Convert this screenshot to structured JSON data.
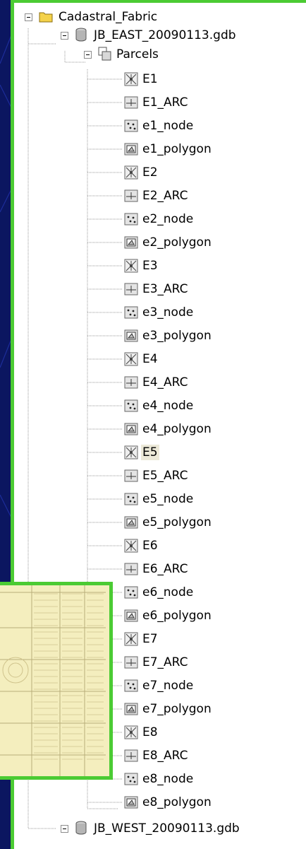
{
  "tree": {
    "root": {
      "label": "Cadastral_Fabric",
      "icon": "folder-icon",
      "expanded": true
    },
    "databases": [
      {
        "label": "JB_EAST_20090113.gdb",
        "icon": "geodatabase-icon",
        "expanded": true,
        "dataset": {
          "label": "Parcels",
          "icon": "feature-dataset-icon",
          "expanded": true,
          "items": [
            {
              "label": "E1",
              "icon": "topology-icon"
            },
            {
              "label": "E1_ARC",
              "icon": "line-feature-class-icon"
            },
            {
              "label": "e1_node",
              "icon": "point-feature-class-icon"
            },
            {
              "label": "e1_polygon",
              "icon": "polygon-feature-class-icon"
            },
            {
              "label": "E2",
              "icon": "topology-icon"
            },
            {
              "label": "E2_ARC",
              "icon": "line-feature-class-icon"
            },
            {
              "label": "e2_node",
              "icon": "point-feature-class-icon"
            },
            {
              "label": "e2_polygon",
              "icon": "polygon-feature-class-icon"
            },
            {
              "label": "E3",
              "icon": "topology-icon"
            },
            {
              "label": "E3_ARC",
              "icon": "line-feature-class-icon"
            },
            {
              "label": "e3_node",
              "icon": "point-feature-class-icon"
            },
            {
              "label": "e3_polygon",
              "icon": "polygon-feature-class-icon"
            },
            {
              "label": "E4",
              "icon": "topology-icon"
            },
            {
              "label": "E4_ARC",
              "icon": "line-feature-class-icon"
            },
            {
              "label": "e4_node",
              "icon": "point-feature-class-icon"
            },
            {
              "label": "e4_polygon",
              "icon": "polygon-feature-class-icon"
            },
            {
              "label": "E5",
              "icon": "topology-icon",
              "selected": true
            },
            {
              "label": "E5_ARC",
              "icon": "line-feature-class-icon"
            },
            {
              "label": "e5_node",
              "icon": "point-feature-class-icon"
            },
            {
              "label": "e5_polygon",
              "icon": "polygon-feature-class-icon"
            },
            {
              "label": "E6",
              "icon": "topology-icon"
            },
            {
              "label": "E6_ARC",
              "icon": "line-feature-class-icon"
            },
            {
              "label": "e6_node",
              "icon": "point-feature-class-icon"
            },
            {
              "label": "e6_polygon",
              "icon": "polygon-feature-class-icon"
            },
            {
              "label": "E7",
              "icon": "topology-icon"
            },
            {
              "label": "E7_ARC",
              "icon": "line-feature-class-icon"
            },
            {
              "label": "e7_node",
              "icon": "point-feature-class-icon"
            },
            {
              "label": "e7_polygon",
              "icon": "polygon-feature-class-icon"
            },
            {
              "label": "E8",
              "icon": "topology-icon"
            },
            {
              "label": "E8_ARC",
              "icon": "line-feature-class-icon"
            },
            {
              "label": "e8_node",
              "icon": "point-feature-class-icon"
            },
            {
              "label": "e8_polygon",
              "icon": "polygon-feature-class-icon"
            }
          ]
        }
      },
      {
        "label": "JB_WEST_20090113.gdb",
        "icon": "geodatabase-icon",
        "expanded": true
      }
    ]
  },
  "colors": {
    "background": "#0b1660",
    "frame_accent": "#4bcb33",
    "selection": "#ece9d8",
    "map_fill": "#f4eebe"
  },
  "map_inset": {
    "icon": "parcel-map-thumbnail"
  }
}
